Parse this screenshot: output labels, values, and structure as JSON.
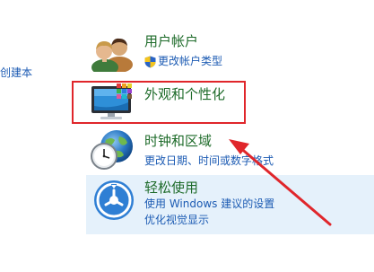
{
  "left_partial_link": "创建本",
  "categories": [
    {
      "title": "用户帐户",
      "links": [
        "更改帐户类型"
      ],
      "icon": "user-accounts-icon",
      "sub_icon": "uac-shield-icon"
    },
    {
      "title": "外观和个性化",
      "links": [],
      "icon": "appearance-personalization-icon"
    },
    {
      "title": "时钟和区域",
      "links": [
        "更改日期、时间或数字格式"
      ],
      "icon": "clock-region-icon"
    },
    {
      "title": "轻松使用",
      "links": [
        "使用 Windows 建议的设置",
        "优化视觉显示"
      ],
      "icon": "ease-of-access-icon"
    }
  ],
  "annotation": {
    "box_color": "#e0262b",
    "arrow_color": "#e0262b"
  },
  "colors": {
    "title_green": "#1e6b2a",
    "link_blue": "#1c5bb3",
    "hover_panel": "#e5f1fb"
  }
}
